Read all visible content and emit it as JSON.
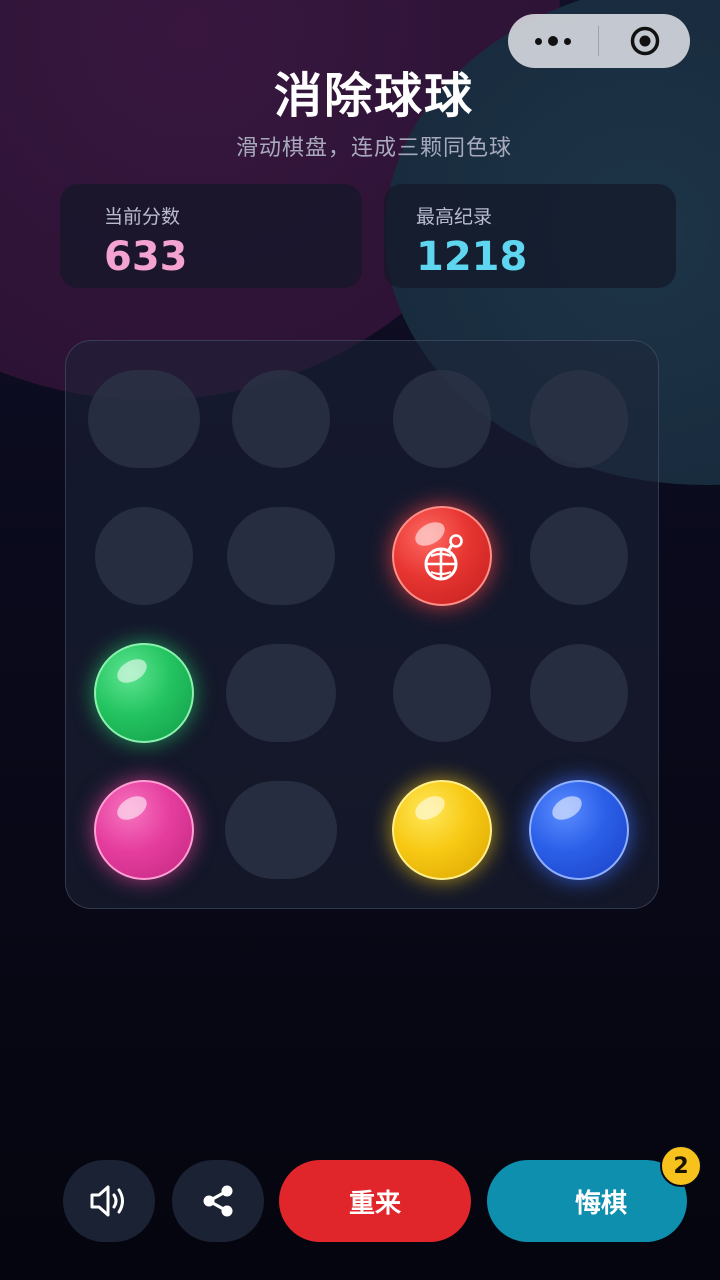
{
  "capsule": {
    "more_icon": "ellipsis-icon",
    "close_icon": "target-circle-icon"
  },
  "header": {
    "title": "消除球球",
    "subtitle": "滑动棋盘，连成三颗同色球"
  },
  "scores": {
    "current_label": "当前分数",
    "current_value": "633",
    "best_label": "最高纪录",
    "best_value": "1218"
  },
  "board": {
    "rows": 4,
    "cols": 4,
    "balls": [
      {
        "row": 1,
        "col": 2,
        "color": "red",
        "special": "bomb"
      },
      {
        "row": 2,
        "col": 0,
        "color": "green"
      },
      {
        "row": 3,
        "col": 0,
        "color": "pink"
      },
      {
        "row": 3,
        "col": 2,
        "color": "yellow"
      },
      {
        "row": 3,
        "col": 3,
        "color": "blue"
      }
    ],
    "colors": {
      "red": "#e73531",
      "green": "#24c461",
      "pink": "#e53d9e",
      "yellow": "#f7c914",
      "blue": "#2b5fe8"
    }
  },
  "controls": {
    "sound_icon": "speaker-icon",
    "share_icon": "share-icon",
    "restart_label": "重来",
    "undo_label": "悔棋",
    "undo_count": "2",
    "restart_color": "#e0262a",
    "undo_color": "#0e8fae"
  }
}
